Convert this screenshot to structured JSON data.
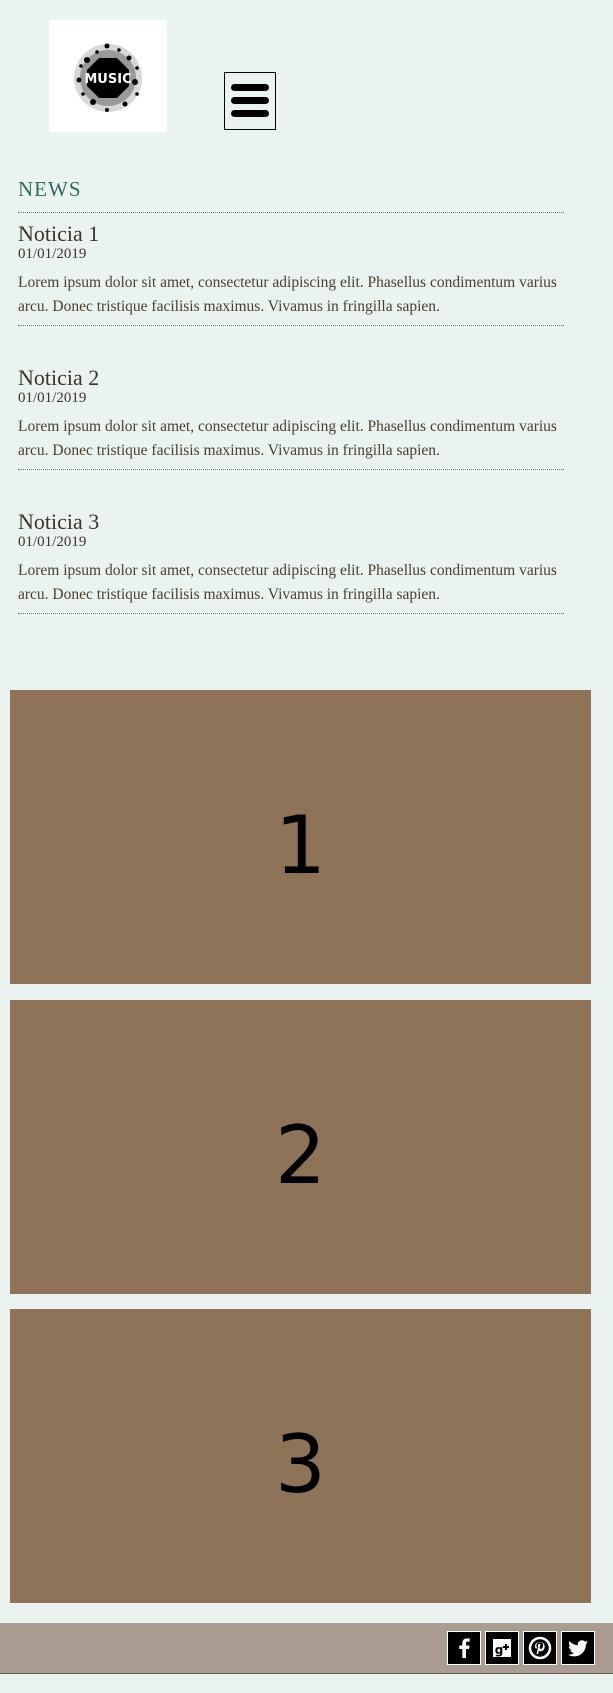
{
  "header": {
    "logo_text": "MUSIC",
    "menu_icon": "hamburger-menu-icon"
  },
  "news": {
    "heading": "NEWS",
    "items": [
      {
        "title": "Noticia 1",
        "date": "01/01/2019",
        "body": "Lorem ipsum dolor sit amet, consectetur adipiscing elit. Phasellus condimentum varius arcu. Donec tristique facilisis maximus. Vivamus in fringilla sapien."
      },
      {
        "title": "Noticia 2",
        "date": "01/01/2019",
        "body": "Lorem ipsum dolor sit amet, consectetur adipiscing elit. Phasellus condimentum varius arcu. Donec tristique facilisis maximus. Vivamus in fringilla sapien."
      },
      {
        "title": "Noticia 3",
        "date": "01/01/2019",
        "body": "Lorem ipsum dolor sit amet, consectetur adipiscing elit. Phasellus condimentum varius arcu. Donec tristique facilisis maximus. Vivamus in fringilla sapien."
      }
    ]
  },
  "slides": [
    {
      "label": "1"
    },
    {
      "label": "2"
    },
    {
      "label": "3"
    }
  ],
  "footer": {
    "social_icons": [
      "facebook-icon",
      "google-plus-icon",
      "pinterest-icon",
      "twitter-icon"
    ]
  },
  "colors": {
    "background": "#ebf3f0",
    "heading_accent": "#2f6b61",
    "slide_background": "#8f7359",
    "footer_background": "#aa9c91",
    "text": "#3d3326"
  }
}
